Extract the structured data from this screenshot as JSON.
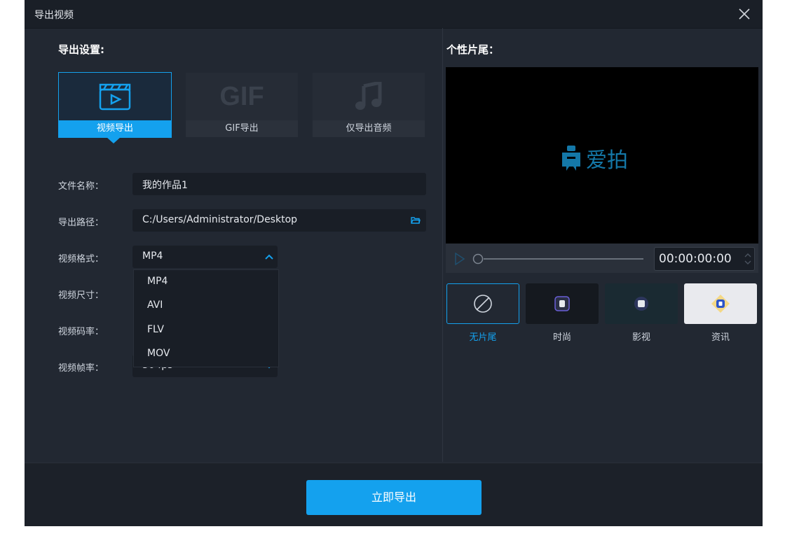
{
  "window": {
    "title": "导出视频"
  },
  "export_settings": {
    "title": "导出设置:",
    "modes": [
      {
        "label": "视频导出",
        "icon": "video-clapper-icon",
        "active": true
      },
      {
        "label": "GIF导出",
        "icon": "gif-icon",
        "active": false
      },
      {
        "label": "仅导出音频",
        "icon": "music-note-icon",
        "active": false
      }
    ],
    "gif_icon_text": "GIF",
    "fields": {
      "filename": {
        "label": "文件名称：",
        "value": "我的作品1"
      },
      "path": {
        "label": "导出路径：",
        "value": "C:/Users/Administrator/Desktop"
      },
      "format": {
        "label": "视频格式：",
        "value": "MP4",
        "options": [
          "MP4",
          "AVI",
          "FLV",
          "MOV"
        ]
      },
      "size": {
        "label": "视频尺寸："
      },
      "bitrate": {
        "label": "视频码率："
      },
      "framerate": {
        "label": "视频帧率：",
        "value": "30 fps"
      }
    }
  },
  "outro": {
    "title": "个性片尾：",
    "preview_logo_text": "爱拍",
    "time": "00:00:00:00",
    "options": [
      {
        "label": "无片尾",
        "icon": "none-circle-icon",
        "selected": true
      },
      {
        "label": "时尚"
      },
      {
        "label": "影视"
      },
      {
        "label": "资讯"
      }
    ]
  },
  "footer": {
    "export_button": "立即导出"
  },
  "colors": {
    "accent": "#14a1ee",
    "background": "#222832"
  }
}
